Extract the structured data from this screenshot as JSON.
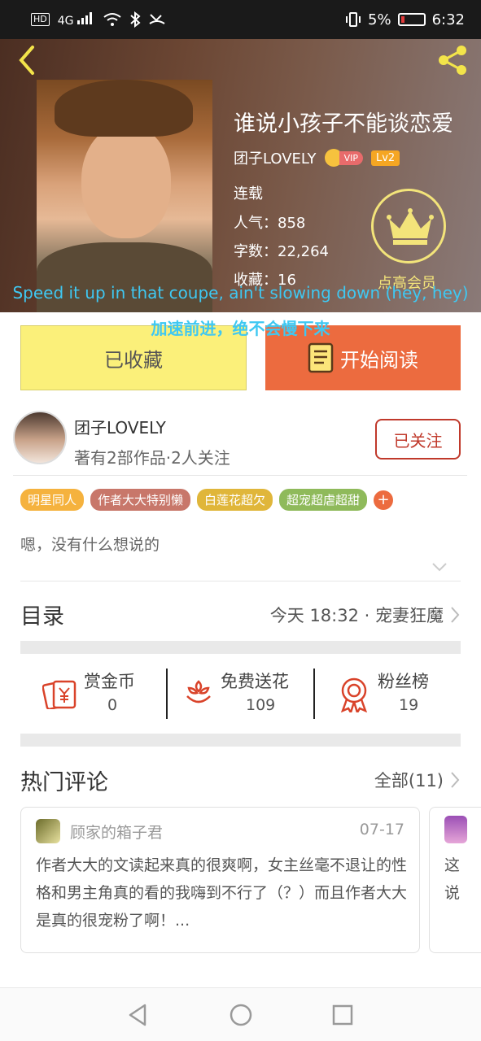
{
  "status_bar": {
    "network": "HD",
    "signal": "4G",
    "battery_percent": "5%",
    "time": "6:32"
  },
  "book": {
    "title": "谁说小孩子不能谈恋爱",
    "author": "团子LOVELY",
    "vip_label": "VIP",
    "level": "Lv2",
    "status": "连载",
    "popularity": "人气：858",
    "word_count": "字数：22,264",
    "favorites": "收藏：16",
    "vip_cta": "点高会员"
  },
  "subtitles": {
    "line1": "Speed it up in that coupe, ain't slowing down (hey, hey)",
    "line2": "加速前进，绝不会慢下来"
  },
  "actions": {
    "favorited_label": "已收藏",
    "read_label": "开始阅读"
  },
  "author_card": {
    "name": "团子LOVELY",
    "stats": "著有2部作品·2人关注",
    "follow_label": "已关注"
  },
  "tags": [
    {
      "label": "明星同人",
      "color": "#f5b23e"
    },
    {
      "label": "作者大大特别懒",
      "color": "#c8776a"
    },
    {
      "label": "白莲花超欠",
      "color": "#e0b63a"
    },
    {
      "label": "超宠超虐超甜",
      "color": "#8fba5b"
    }
  ],
  "tag_add": "+",
  "description": "嗯，没有什么想说的",
  "toc": {
    "title": "目录",
    "latest": "今天 18:32 · 宠妻狂魔"
  },
  "stats": [
    {
      "label": "赏金币",
      "value": "0"
    },
    {
      "label": "免费送花",
      "value": "109"
    },
    {
      "label": "粉丝榜",
      "value": "19"
    }
  ],
  "comments_section": {
    "title": "热门评论",
    "all_label": "全部(11)"
  },
  "comments": [
    {
      "user": "顾家的箱子君",
      "date": "07-17",
      "text": "作者大大的文读起来真的很爽啊，女主丝毫不退让的性格和男主角真的看的我嗨到不行了（？）而且作者大大是真的很宠粉了啊！..."
    },
    {
      "text_line1": "这",
      "text_line2": "说"
    }
  ],
  "colors": {
    "accent": "#ec6b3f",
    "favorite_button": "#fbf07a",
    "follow_border": "#c0392b",
    "caption": "#3fc8f2"
  }
}
